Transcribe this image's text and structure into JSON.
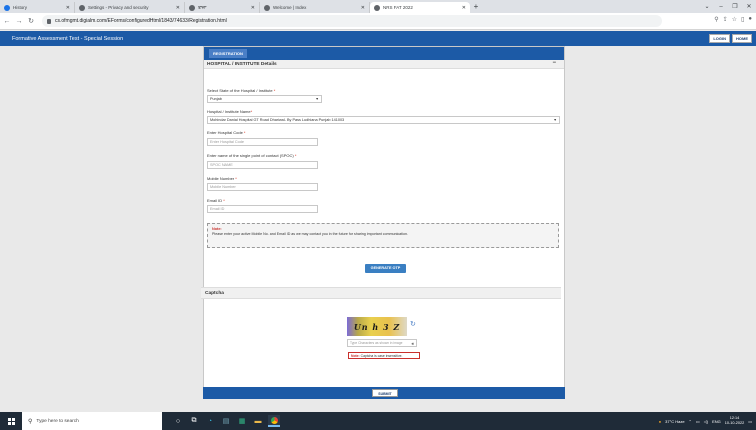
{
  "browser": {
    "tabs": [
      {
        "title": "History"
      },
      {
        "title": "Settings - Privacy and security"
      },
      {
        "title": "ਤਾਜ਼ਾ"
      },
      {
        "title": "Welcome | Index"
      },
      {
        "title": "NRS FAT 2022"
      }
    ],
    "new_tab": "+",
    "url": "cs.ofmgmt.digialm.com/EForms/configuredHtml/1843/74633/Registration.html"
  },
  "site": {
    "title": "Formative Assessment Test - Special Session",
    "login_label": "LOGIN",
    "home_label": "HOME"
  },
  "form": {
    "tab_label": "REGISTRATION",
    "section_title": "HOSPITAL / INSTITUTE Details",
    "state_label": "Select State of the Hospital / Institute",
    "state_value": "Punjab",
    "hospital_label": "Hospital / Institute Name",
    "hospital_value": "Mohindar Danial Hospital GT Road Dhariwal- By Pass Ludhiana Punjab 141003",
    "code_label": "Enter Hospital Code",
    "code_placeholder": "Enter Hospital Code",
    "spoc_label": "Enter name of the single point of contact (SPOC)",
    "spoc_placeholder": "SPOC NAME",
    "mobile_label": "Mobile Number",
    "mobile_placeholder": "Mobile Number",
    "email_label": "Email ID",
    "email_placeholder": "Email ID",
    "note_title": "Note:",
    "note_text": "Please enter your active Mobile No. and Email ID as we may contact you in the future for sharing important communication.",
    "otp_label": "GENERATE OTP",
    "captcha_title": "Captcha",
    "captcha_text": "Un h 3 Z",
    "captcha_placeholder": "Type Characters as shown in image",
    "captcha_note_bold": "Note:",
    "captcha_note": "Captcha is case insensitive.",
    "submit_label": "SUBMIT"
  },
  "taskbar": {
    "search_placeholder": "Type here to search",
    "weather": "37°C Haze",
    "lang": "ENG",
    "time": "12:14",
    "date": "10-10-2022"
  }
}
